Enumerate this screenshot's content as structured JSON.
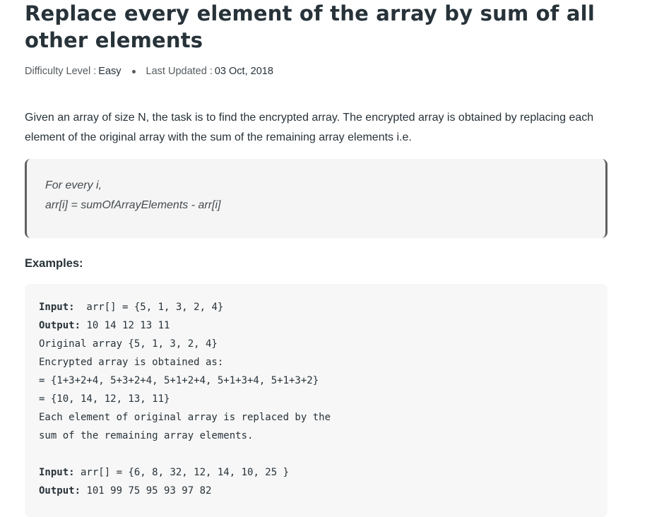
{
  "article": {
    "title": "Replace every element of the array by sum of all other elements",
    "meta": {
      "difficulty_label": "Difficulty Level :",
      "difficulty_value": "Easy",
      "updated_label": "Last Updated :",
      "updated_value": "03 Oct, 2018"
    },
    "intro": "Given an array of size N, the task is to find the encrypted array. The encrypted array is obtained by replacing each element of the original array with the sum of the remaining array elements i.e.",
    "quote": {
      "line1": "For every i,",
      "line2": "arr[i] = sumOfArrayElements - arr[i]"
    },
    "examples_heading": "Examples:",
    "examples": {
      "ex1_input_label": "Input:",
      "ex1_input_value": "  arr[] = {5, 1, 3, 2, 4}",
      "ex1_output_label": "Output:",
      "ex1_output_value": " 10 14 12 13 11",
      "ex1_line3": "Original array {5, 1, 3, 2, 4}",
      "ex1_line4": "Encrypted array is obtained as:",
      "ex1_line5": "= {1+3+2+4, 5+3+2+4, 5+1+2+4, 5+1+3+4, 5+1+3+2}",
      "ex1_line6": "= {10, 14, 12, 13, 11}",
      "ex1_line7": "Each element of original array is replaced by the",
      "ex1_line8": "sum of the remaining array elements.",
      "ex2_input_label": "Input:",
      "ex2_input_value": " arr[] = {6, 8, 32, 12, 14, 10, 25 }",
      "ex2_output_label": "Output:",
      "ex2_output_value": " 101 99 75 95 93 97 82"
    }
  }
}
